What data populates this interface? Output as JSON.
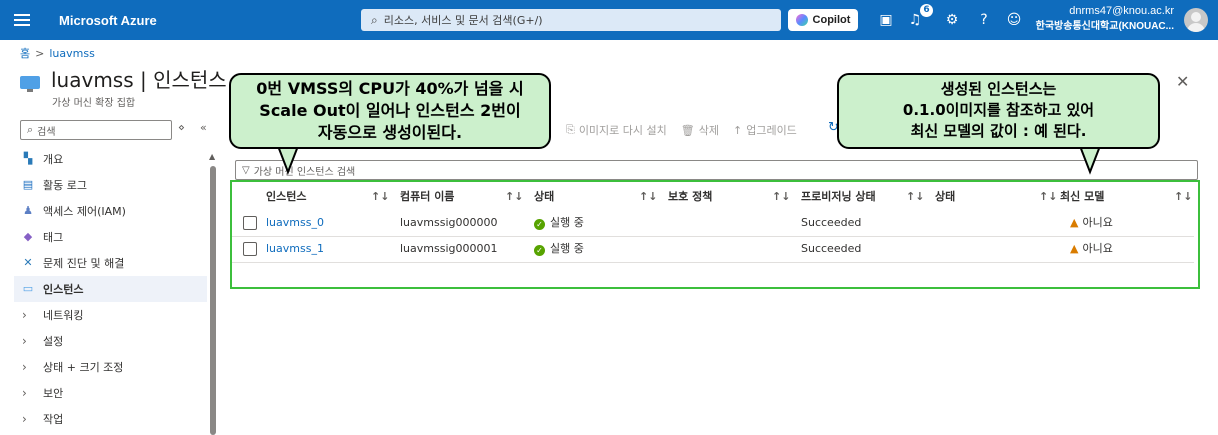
{
  "topbar": {
    "brand": "Microsoft Azure",
    "search_placeholder": "리소스, 서비스 및 문서 검색(G+/)",
    "copilot_label": "Copilot",
    "notification_count": "6",
    "account_email": "dnrms47@knou.ac.kr",
    "account_org": "한국방송통신대학교(KNOUAC..."
  },
  "breadcrumb": {
    "home": "홈",
    "current": "luavmss"
  },
  "page": {
    "title": "luavmss | 인스턴스",
    "subtitle": "가상 머신 확장 집합"
  },
  "sidebar": {
    "search_placeholder": "검색",
    "items": [
      {
        "label": "개요",
        "icon": "overview-icon"
      },
      {
        "label": "활동 로그",
        "icon": "activity-log-icon"
      },
      {
        "label": "액세스 제어(IAM)",
        "icon": "iam-icon"
      },
      {
        "label": "태그",
        "icon": "tag-icon"
      },
      {
        "label": "문제 진단 및 해결",
        "icon": "diagnose-icon"
      },
      {
        "label": "인스턴스",
        "icon": "instances-icon",
        "active": true
      }
    ],
    "groups": [
      "네트워킹",
      "설정",
      "상태 + 크기 조정",
      "보안",
      "작업"
    ]
  },
  "toolbar": {
    "reimage": "이미지로 다시 설치",
    "delete": "삭제",
    "upgrade": "업그레이드"
  },
  "filter": {
    "placeholder": "가상 머신 인스턴스 검색"
  },
  "table": {
    "columns": [
      "인스턴스",
      "컴퓨터 이름",
      "상태",
      "보호 정책",
      "프로비저닝 상태",
      "상태",
      "최신 모델"
    ],
    "rows": [
      {
        "instance": "luavmss_0",
        "computer": "luavmssig000000",
        "status": "실행 중",
        "protection": "",
        "provisioning": "Succeeded",
        "health": "",
        "latest": "아니요"
      },
      {
        "instance": "luavmss_1",
        "computer": "luavmssig000001",
        "status": "실행 중",
        "protection": "",
        "provisioning": "Succeeded",
        "health": "",
        "latest": "아니요"
      }
    ]
  },
  "callouts": {
    "left": [
      "0번 VMSS의 CPU가 40%가 넘을 시",
      "Scale Out이 일어나 인스턴스 2번이",
      "자동으로 생성이된다."
    ],
    "right": [
      "생성된 인스턴스는",
      "0.1.0이미지를 참조하고 있어",
      "최신 모델의 값이 : 예 된다."
    ]
  },
  "colors": {
    "azure_blue": "#0f6cbd",
    "callout_bg": "#ccf0cc",
    "highlight_border": "#3cbf3c",
    "running_green": "#57a300",
    "warning_orange": "#d97c00"
  }
}
